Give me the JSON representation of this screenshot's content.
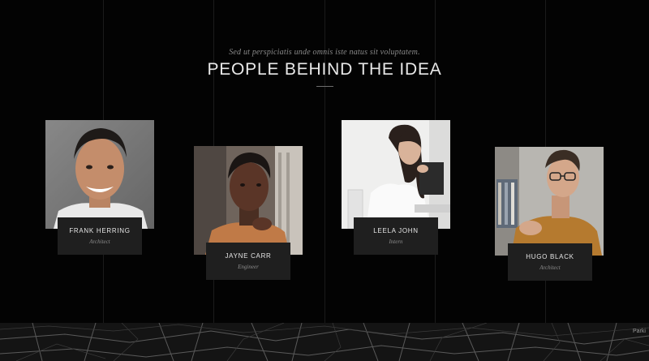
{
  "section": {
    "subtitle": "Sed ut perspiciatis unde omnis iste natus sit voluptatem.",
    "title": "PEOPLE BEHIND THE IDEA"
  },
  "team": [
    {
      "name": "FRANK HERRING",
      "role": "Architect"
    },
    {
      "name": "JAYNE CARR",
      "role": "Engineer"
    },
    {
      "name": "LEELA JOHN",
      "role": "Intern"
    },
    {
      "name": "HUGO BLACK",
      "role": "Architect"
    }
  ],
  "map": {
    "label": "Parki"
  }
}
